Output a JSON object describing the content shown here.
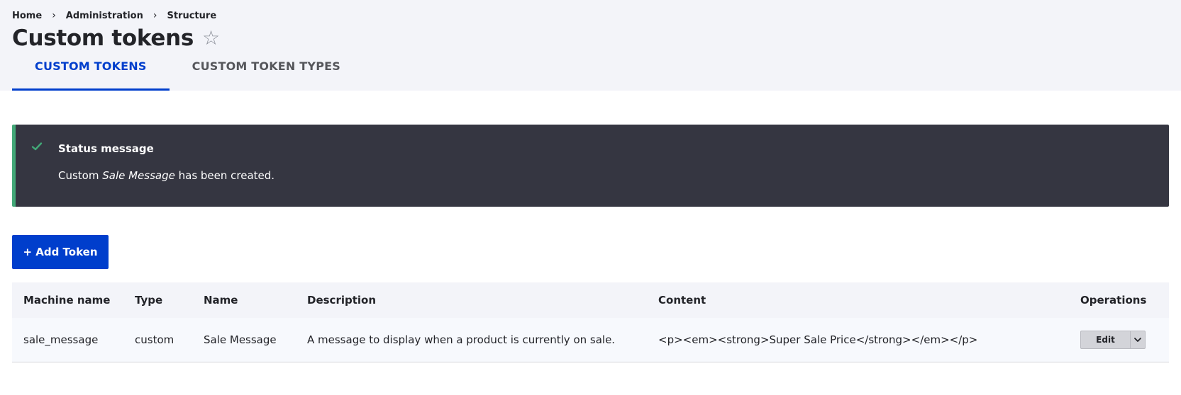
{
  "breadcrumb": [
    "Home",
    "Administration",
    "Structure"
  ],
  "page": {
    "title": "Custom tokens"
  },
  "tabs": [
    "CUSTOM TOKENS",
    "CUSTOM TOKEN TYPES"
  ],
  "status": {
    "title": "Status message",
    "text_before": "Custom ",
    "text_em": "Sale Message",
    "text_after": " has been created."
  },
  "actions": {
    "add_token": "+ Add Token"
  },
  "table": {
    "headers": [
      "Machine name",
      "Type",
      "Name",
      "Description",
      "Content",
      "Operations"
    ],
    "rows": [
      {
        "machine_name": "sale_message",
        "type": "custom",
        "name": "Sale Message",
        "description": "A message to display when a product is currently on sale.",
        "content": "<p><em><strong>Super Sale Price</strong></em></p>",
        "edit_label": "Edit"
      }
    ]
  },
  "colors": {
    "accent": "#003ecc",
    "status_bg": "#353641",
    "status_border": "#42a877"
  }
}
